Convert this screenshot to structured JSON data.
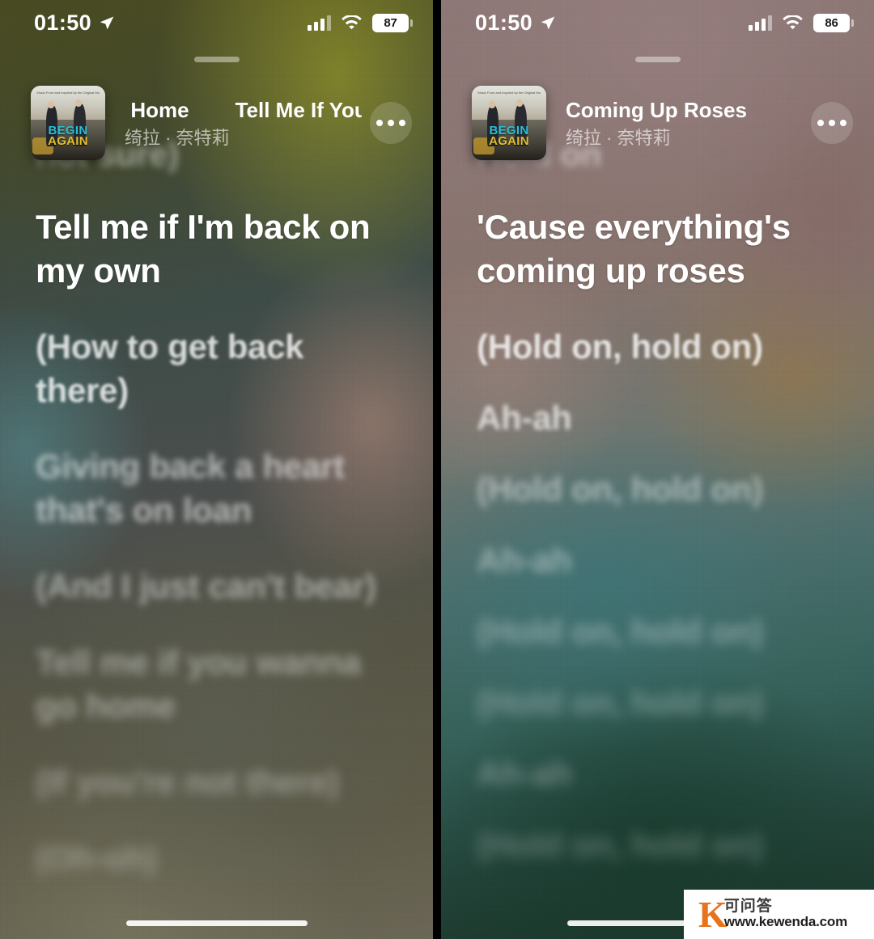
{
  "panels": [
    {
      "status": {
        "time": "01:50",
        "location_icon": "location-arrow-icon",
        "signal_icon": "cellular-signal-icon",
        "wifi_icon": "wifi-icon",
        "battery": "87"
      },
      "grabber": "drag-handle",
      "now_playing": {
        "album_art": {
          "title_line1": "BEGIN",
          "title_line2": "AGAIN",
          "caption": "Music From and Inspired by the Original Motion Picture"
        },
        "title_trailing": "Go Home",
        "title_incoming": "Tell Me If You Wan",
        "artist": "绮拉 · 奈特莉",
        "more_button": "more-options"
      },
      "lyrics": [
        {
          "text": "not sure)",
          "state": "past-cut"
        },
        {
          "text": "Tell me if I'm back on my own",
          "state": "active"
        },
        {
          "text": "(How to get back there)",
          "state": "next-1"
        },
        {
          "text": "Giving back a heart that's on loan",
          "state": "next-2"
        },
        {
          "text": "(And I just can't bear)",
          "state": "next-3"
        },
        {
          "text": "Tell me if you wanna go home",
          "state": "next-4"
        },
        {
          "text": "(If you're not there)",
          "state": "next-5"
        },
        {
          "text": "(Oh-oh)",
          "state": "next-6"
        }
      ],
      "home_indicator": "home-indicator"
    },
    {
      "status": {
        "time": "01:50",
        "location_icon": "location-arrow-icon",
        "signal_icon": "cellular-signal-icon",
        "wifi_icon": "wifi-icon",
        "battery": "86"
      },
      "grabber": "drag-handle",
      "now_playing": {
        "album_art": {
          "title_line1": "BEGIN",
          "title_line2": "AGAIN",
          "caption": "Music From and Inspired by the Original Motion Picture"
        },
        "title_trailing": "Coming Up Roses",
        "title_incoming": "",
        "artist": "绮拉 · 奈特莉",
        "more_button": "more-options"
      },
      "lyrics": [
        {
          "text": "Hold on",
          "state": "past-cut"
        },
        {
          "text": "'Cause everything's coming up roses",
          "state": "active"
        },
        {
          "text": "(Hold on, hold on)",
          "state": "next-1"
        },
        {
          "text": "Ah-ah",
          "state": "next-2"
        },
        {
          "text": "(Hold on, hold on)",
          "state": "next-3"
        },
        {
          "text": "Ah-ah",
          "state": "next-4"
        },
        {
          "text": "(Hold on, hold on)",
          "state": "next-5"
        },
        {
          "text": "(Hold on, hold on)",
          "state": "next-6"
        },
        {
          "text": "Ah-ah",
          "state": "next-7"
        },
        {
          "text": "(Hold on, hold on)",
          "state": "next-8"
        }
      ],
      "home_indicator": "home-indicator"
    }
  ],
  "watermark": {
    "logo_letter": "K",
    "cn_text": "可问答",
    "url": "www.kewenda.com"
  },
  "colors": {
    "active_lyric": "#ffffff",
    "inactive_lyric": "rgba(255,255,255,0.72)",
    "artist": "rgba(255,255,255,0.62)",
    "watermark_orange": "#e8731b"
  }
}
